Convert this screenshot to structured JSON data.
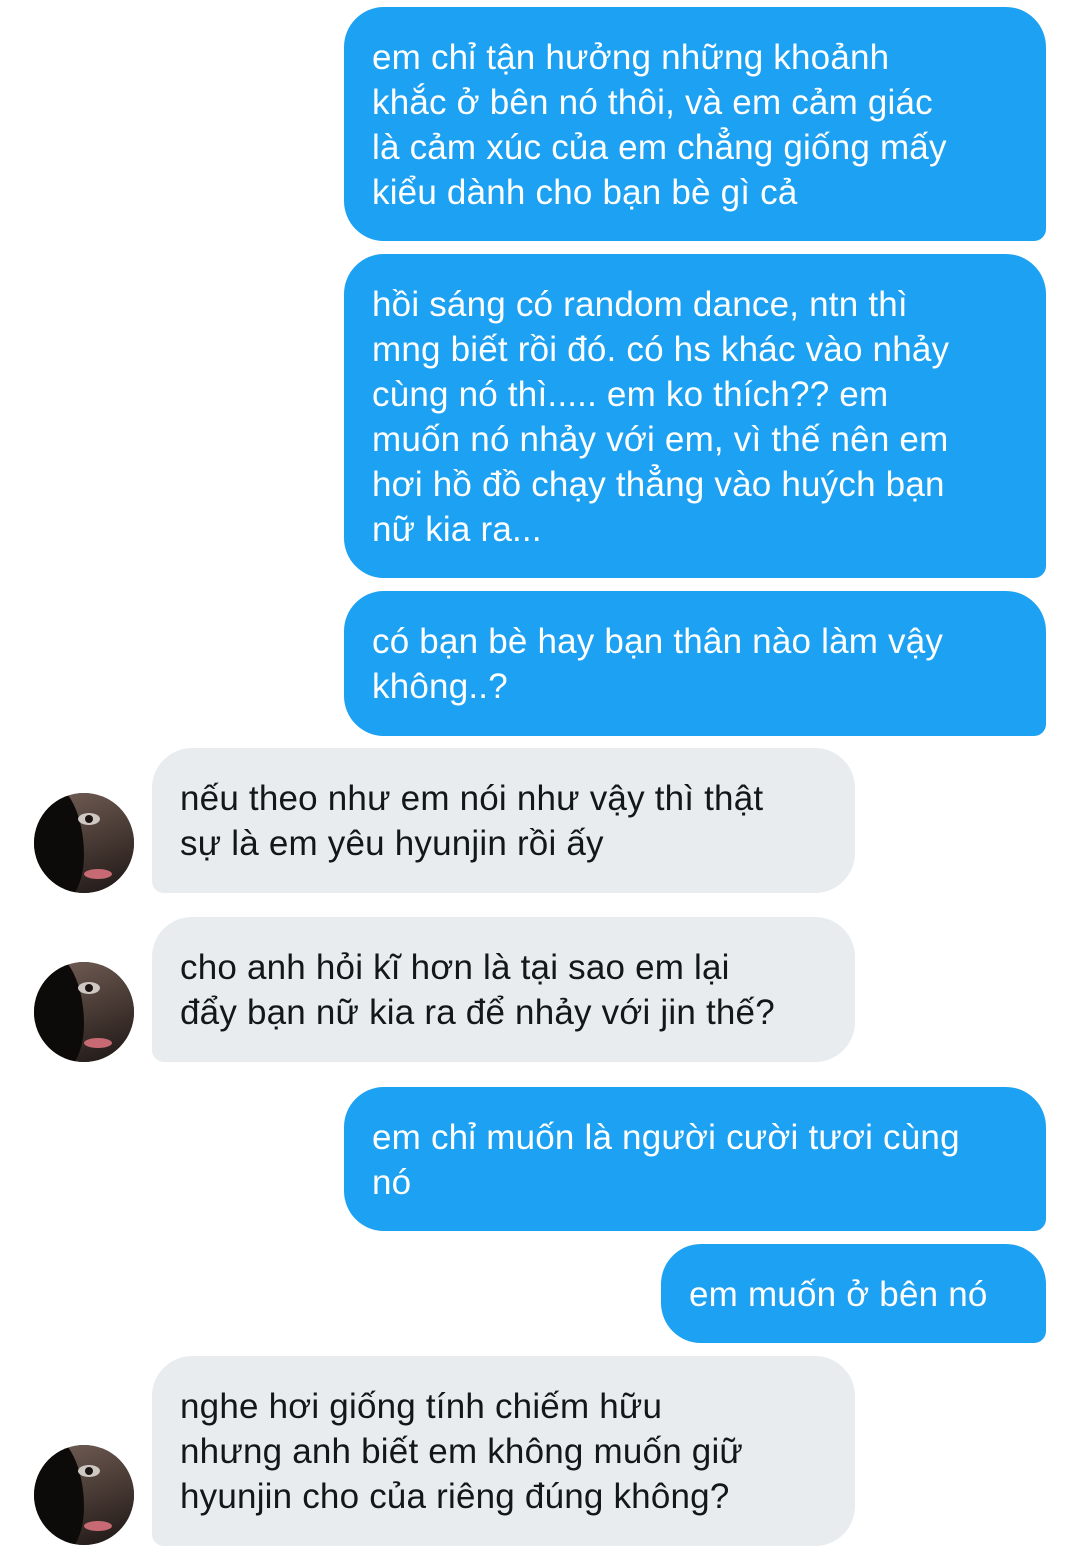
{
  "conversation": {
    "messages": [
      {
        "from": "me",
        "text": "em chỉ tận hưởng những khoảnh\nkhắc ở bên nó thôi, và em cảm giác\nlà cảm xúc của em chẳng giống mấy\nkiểu dành cho bạn bè gì cả"
      },
      {
        "from": "me",
        "text": "hồi sáng có random dance, ntn thì\nmng biết rồi đó. có hs khác vào nhảy\ncùng nó thì..... em ko thích?? em\nmuốn nó nhảy với em, vì thế nên em\nhơi hồ đồ chạy thẳng vào huých bạn\nnữ kia ra..."
      },
      {
        "from": "me",
        "text": "có bạn bè hay bạn thân nào làm vậy\nkhông..?"
      },
      {
        "from": "them",
        "text": "nếu theo như em nói như vậy thì thật\nsự là em yêu hyunjin rồi ấy"
      },
      {
        "from": "them",
        "text": "cho anh hỏi kĩ hơn là tại sao em lại\nđẩy bạn nữ kia ra để nhảy với jin thế?"
      },
      {
        "from": "me",
        "text": "em chỉ muốn là người cười tươi cùng\nnó"
      },
      {
        "from": "me",
        "text": "em muốn ở bên nó"
      },
      {
        "from": "them",
        "text": "nghe hơi giống tính chiếm hữu\nnhưng anh biết em không muốn giữ\nhyunjin cho của riêng đúng không?"
      }
    ]
  },
  "colors": {
    "outgoing_bubble": "#1da1f2",
    "incoming_bubble": "#e8ecef",
    "outgoing_text": "#ffffff",
    "incoming_text": "#14171a",
    "background": "#ffffff"
  },
  "icons": {
    "contact_avatar": "avatar-photo"
  }
}
